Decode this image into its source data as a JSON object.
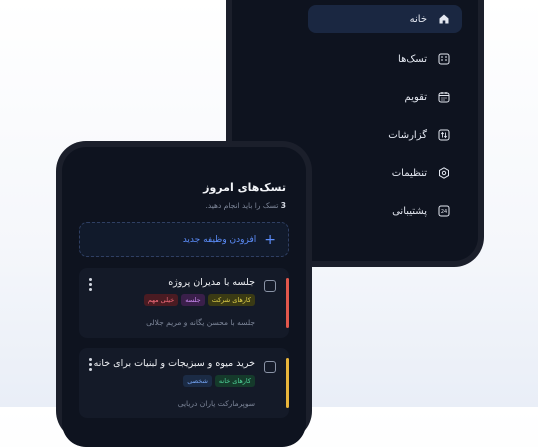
{
  "menu": {
    "items": [
      {
        "label": "خانه",
        "icon": "home-icon",
        "active": true
      },
      {
        "label": "تسک‌ها",
        "icon": "task-list-icon",
        "active": false
      },
      {
        "label": "تقویم",
        "icon": "calendar-icon",
        "active": false
      },
      {
        "label": "گزارشات",
        "icon": "report-icon",
        "active": false
      },
      {
        "label": "تنظیمات",
        "icon": "settings-icon",
        "active": false
      },
      {
        "label": "پشتیبانی",
        "icon": "support-24-icon",
        "active": false
      }
    ],
    "support_badge": "24"
  },
  "tasks_page": {
    "title": "تسک‌های امروز",
    "count": "3",
    "subtitle_rest": " تسک را باید انجام دهید.",
    "add_button": "افزودن وظیفه جدید",
    "add_icon": "+",
    "tasks": [
      {
        "title": "جلسه با مدیران پروژه",
        "tags": [
          {
            "label": "کارهای شرکت",
            "bg": "#3a3a14",
            "fg": "#e6d54a"
          },
          {
            "label": "جلسه",
            "bg": "#3a1f4a",
            "fg": "#c889f0"
          },
          {
            "label": "خیلی مهم",
            "bg": "#4a1b22",
            "fg": "#f06b7a"
          }
        ],
        "description": "جلسه با محسن یگانه و مریم جلالی",
        "accent": "#e2574c"
      },
      {
        "title": "خرید میوه و سبزیجات و لبنیات برای خانه",
        "tags": [
          {
            "label": "کارهای خانه",
            "bg": "#153a2b",
            "fg": "#4fd59a"
          },
          {
            "label": "شخصی",
            "bg": "#1b2b45",
            "fg": "#74a3f2"
          }
        ],
        "description": "سوپرمارکت یاران دریایی",
        "accent": "#e9b53b"
      }
    ]
  }
}
